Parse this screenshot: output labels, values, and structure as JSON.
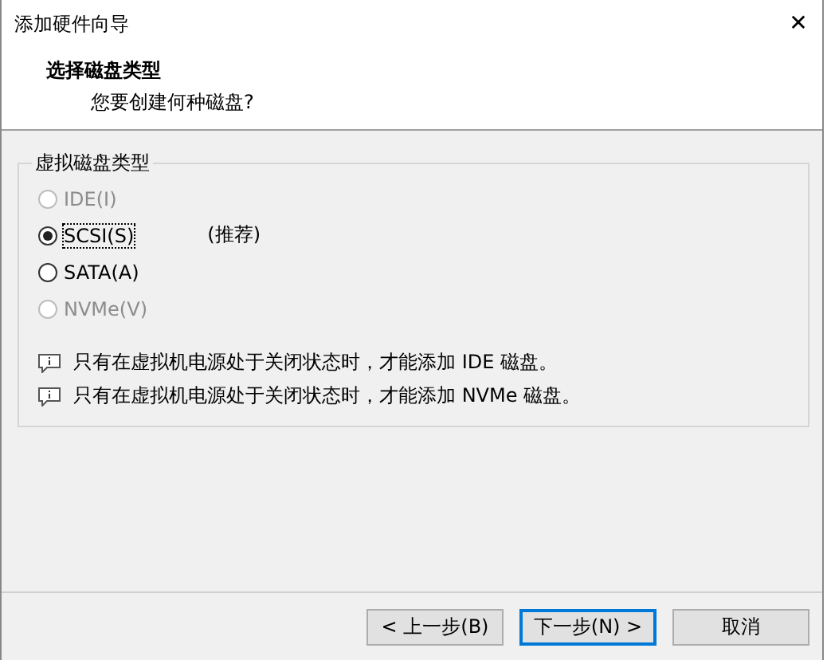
{
  "window": {
    "title": "添加硬件向导",
    "close": "✕"
  },
  "header": {
    "title": "选择磁盘类型",
    "subtitle": "您要创建何种磁盘?"
  },
  "group": {
    "title": "虚拟磁盘类型",
    "options": [
      {
        "label": "IDE(I)",
        "selected": false,
        "disabled": true
      },
      {
        "label": "SCSI(S)",
        "note": "(推荐)",
        "selected": true,
        "disabled": false
      },
      {
        "label": "SATA(A)",
        "selected": false,
        "disabled": false
      },
      {
        "label": "NVMe(V)",
        "selected": false,
        "disabled": true
      }
    ],
    "notes": [
      "只有在虚拟机电源处于关闭状态时，才能添加 IDE 磁盘。",
      "只有在虚拟机电源处于关闭状态时，才能添加 NVMe 磁盘。"
    ]
  },
  "buttons": [
    {
      "label": "< 上一步(B)",
      "selected": false
    },
    {
      "label": "下一步(N) >",
      "selected": true
    },
    {
      "label": "取消",
      "selected": false
    }
  ]
}
